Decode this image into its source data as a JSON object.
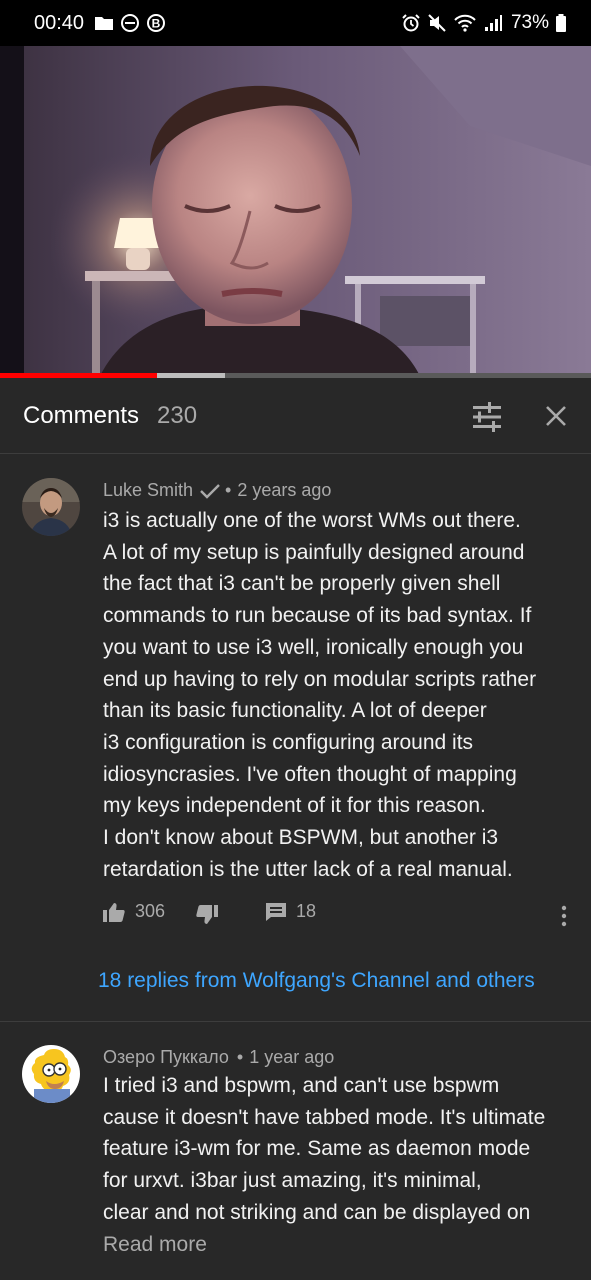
{
  "status_bar": {
    "time": "00:40",
    "battery": "73%"
  },
  "video": {
    "progress_played": 0.265,
    "progress_buffered": 0.38
  },
  "comments_panel": {
    "title": "Comments",
    "count": "230"
  },
  "comments": [
    {
      "author": "Luke Smith",
      "verified": true,
      "time": "2 years ago",
      "text": "i3 is actually one of the worst WMs out there.\nA lot of my setup is painfully designed around\nthe fact that i3 can't be properly given shell\ncommands to run because of its bad syntax. If\nyou want to use i3 well, ironically enough you\nend up having to rely on modular scripts rather\nthan its basic functionality. A lot of deeper\ni3 configuration is configuring around its\nidiosyncrasies. I've often thought of mapping\nmy keys independent of it for this reason.\nI don't know about BSPWM, but another i3\nretardation is the utter lack of a real manual.",
      "likes": "306",
      "reply_count": "18",
      "replies_link": "18 replies from Wolfgang's Channel and others"
    },
    {
      "author": "Озеро Пуккало",
      "time": "1 year ago",
      "text": "I tried i3 and bspwm, and can't use bspwm\ncause it doesn't have tabbed mode. It's ultimate\nfeature i3-wm for me. Same as daemon mode\nfor urxvt. i3bar just amazing, it's minimal,\nclear and not striking and can be displayed on",
      "read_more": "Read more"
    }
  ],
  "colors": {
    "background": "#282828",
    "link": "#3ea6ff",
    "progress_red": "#ff0000",
    "secondary_text": "#aaaaaa"
  }
}
